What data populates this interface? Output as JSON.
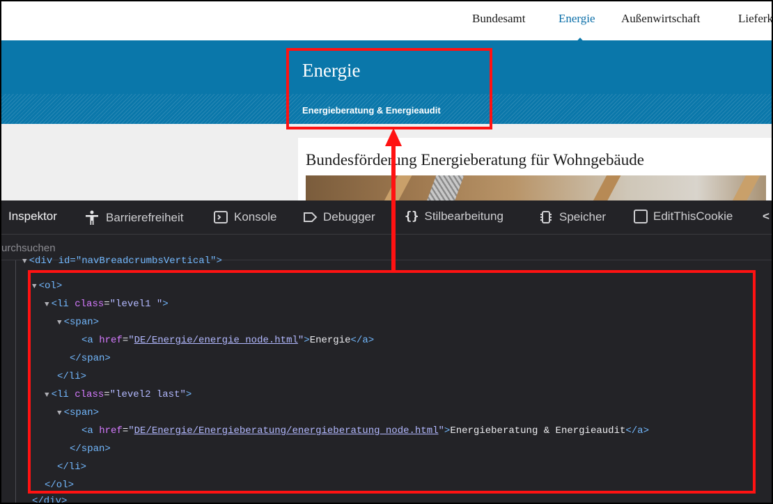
{
  "website": {
    "nav": {
      "items": [
        "Bundesamt",
        "Energie",
        "Außenwirtschaft",
        "Lieferk"
      ],
      "active_index": 1
    },
    "banner": {
      "title": "Energie",
      "breadcrumb": "Energieberatung & Energieaudit"
    },
    "article": {
      "title": "Bundesförderung Energieberatung für Wohngebäude"
    }
  },
  "devtools": {
    "tabs": [
      {
        "label": "Inspektor",
        "icon": "inspector-icon",
        "active": true
      },
      {
        "label": "Barrierefreiheit",
        "icon": "accessibility-icon"
      },
      {
        "label": "Konsole",
        "icon": "console-icon"
      },
      {
        "label": "Debugger",
        "icon": "debugger-icon"
      },
      {
        "label": "Stilbearbeitung",
        "icon": "braces-icon"
      },
      {
        "label": "Speicher",
        "icon": "memory-icon"
      },
      {
        "label": "EditThisCookie",
        "icon": "checkbox-icon"
      }
    ],
    "overflow_chevron": "<",
    "search": {
      "placeholder": "urchsuchen"
    },
    "tree": {
      "div_open": "<div id=\"navBreadcrumbsVertical\">",
      "ol_open": "<ol>",
      "li1_tag": "<li",
      "li_attr": "class",
      "li1_class": "\"level1 \"",
      "span_open": "<span>",
      "a_open": "<a",
      "a_attr": "href",
      "link1_href": "DE/Energie/energie_node.html",
      "link1_text": "Energie",
      "a_close": "</a>",
      "span_close": "</span>",
      "li_close": "</li>",
      "li2_class": "\"level2 last\"",
      "link2_href": "DE/Energie/Energieberatung/energieberatung_node.html",
      "link2_text": "Energieberatung & Energieaudit",
      "ol_close": "</ol>",
      "div_close": "</div>"
    }
  },
  "annotation_color": "#ff1212"
}
